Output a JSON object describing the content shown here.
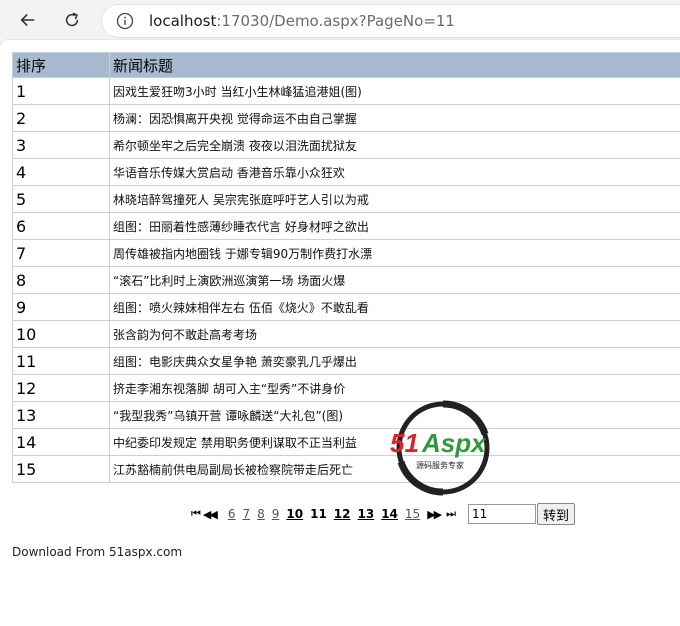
{
  "browser": {
    "url_host": "localhost",
    "url_rest": ":17030/Demo.aspx?PageNo=11"
  },
  "table": {
    "headers": [
      "排序",
      "新闻标题"
    ],
    "rows": [
      {
        "no": "1",
        "title": "因戏生爱狂吻3小时 当红小生林峰猛追港姐(图)"
      },
      {
        "no": "2",
        "title": "杨澜：因恐惧离开央视 觉得命运不由自己掌握"
      },
      {
        "no": "3",
        "title": "希尔顿坐牢之后完全崩溃 夜夜以泪洗面扰狱友"
      },
      {
        "no": "4",
        "title": "华语音乐传媒大赏启动 香港音乐靠小众狂欢"
      },
      {
        "no": "5",
        "title": "林晓培醉驾撞死人 吴宗宪张庭呼吁艺人引以为戒"
      },
      {
        "no": "6",
        "title": "组图：田丽着性感薄纱睡衣代言 好身材呼之欲出"
      },
      {
        "no": "7",
        "title": "周传雄被指内地圈钱 于娜专辑90万制作费打水漂"
      },
      {
        "no": "8",
        "title": "“滚石”比利时上演欧洲巡演第一场 场面火爆"
      },
      {
        "no": "9",
        "title": "组图：喷火辣妹相伴左右 伍佰《烧火》不敢乱看"
      },
      {
        "no": "10",
        "title": "张含韵为何不敢赴高考考场"
      },
      {
        "no": "11",
        "title": "组图：电影庆典众女星争艳 萧奕豪乳几乎爆出"
      },
      {
        "no": "12",
        "title": "挤走李湘东视落脚 胡可入主“型秀”不讲身价"
      },
      {
        "no": "13",
        "title": "“我型我秀”乌镇开营 谭咏麟送“大礼包”(图)"
      },
      {
        "no": "14",
        "title": "中纪委印发规定 禁用职务便利谋取不正当利益"
      },
      {
        "no": "15",
        "title": "江苏豁楠前供电局副局长被检察院带走后死亡"
      }
    ]
  },
  "pager": {
    "first": "⏮",
    "prev": "◀◀",
    "pages": [
      {
        "label": "6",
        "style": "link"
      },
      {
        "label": "7",
        "style": "link"
      },
      {
        "label": "8",
        "style": "link"
      },
      {
        "label": "9",
        "style": "link"
      },
      {
        "label": "10",
        "style": "bold"
      },
      {
        "label": "11",
        "style": "current"
      },
      {
        "label": "12",
        "style": "bold"
      },
      {
        "label": "13",
        "style": "bold"
      },
      {
        "label": "14",
        "style": "bold"
      },
      {
        "label": "15",
        "style": "link"
      }
    ],
    "next": "▶▶",
    "last": "⏭",
    "goto_value": "11",
    "goto_button": "转到"
  },
  "footer": "Download From 51aspx.com",
  "watermark": {
    "brand_a": "51",
    "brand_b": "Aspx",
    "tagline": "源码服务专家"
  },
  "colors": {
    "header_bg": "#a7bad0",
    "grid": "#c6d0da",
    "watermark_red": "#d9262c",
    "watermark_green": "#2f9a3c"
  }
}
